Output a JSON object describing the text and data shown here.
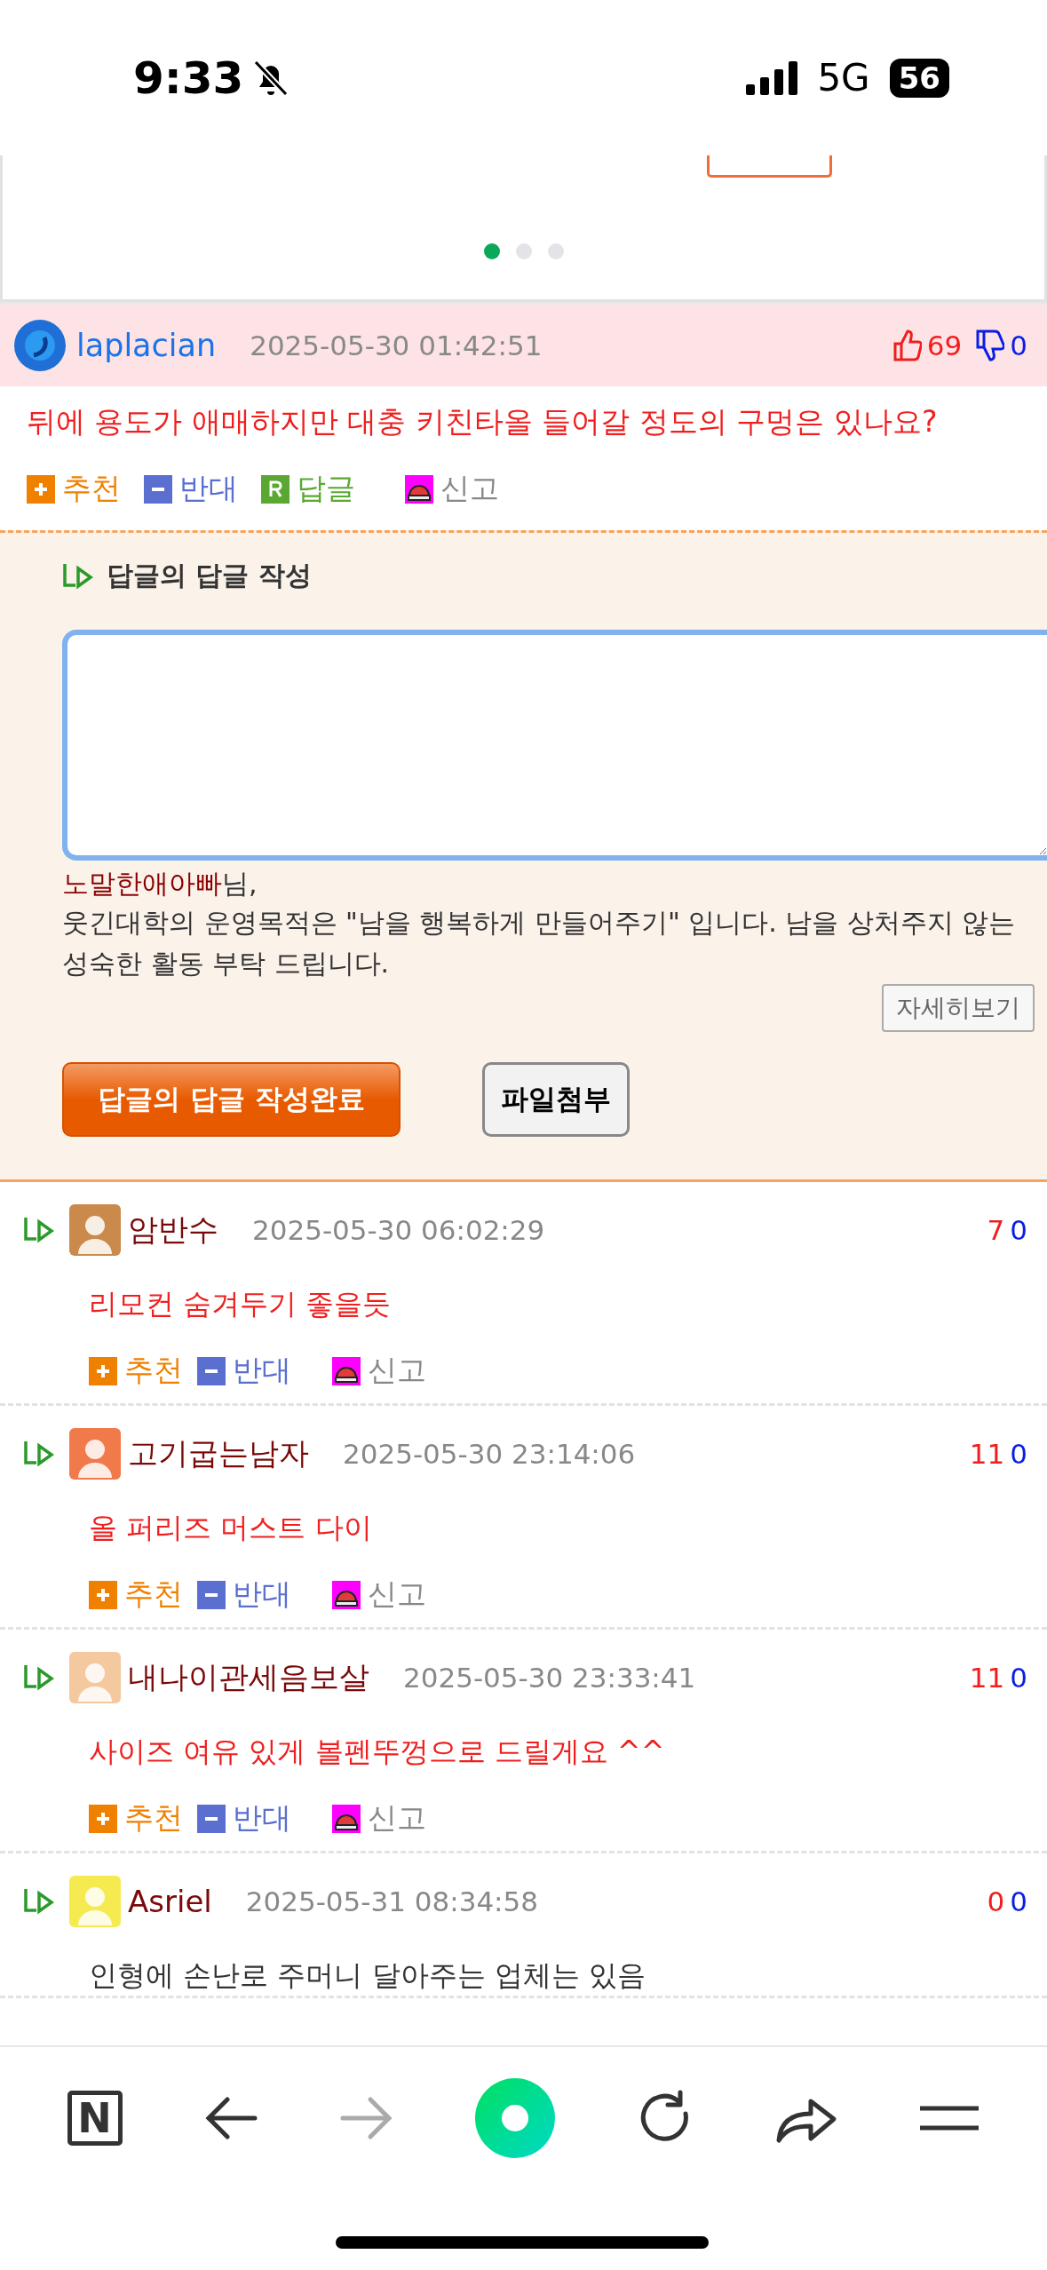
{
  "status_bar": {
    "time": "9:33",
    "network": "5G",
    "battery": "56"
  },
  "carousel": {
    "dots": [
      {
        "selected": true
      },
      {
        "selected": false
      },
      {
        "selected": false
      }
    ]
  },
  "comment": {
    "author": "laplacian",
    "date": "2025-05-30 01:42:51",
    "likes": "69",
    "dislikes": "0",
    "text": "뒤에 용도가 애매하지만 대충 키친타올 들어갈 정도의 구멍은 있나요?",
    "actions": [
      {
        "kind": "up",
        "label": "추천"
      },
      {
        "kind": "down",
        "label": "반대"
      },
      {
        "kind": "reply",
        "label": "답글"
      },
      {
        "kind": "report",
        "label": "신고"
      }
    ]
  },
  "reply_form": {
    "title": "답글의 답글 작성",
    "notice_name": "노말한애아빠",
    "notice_suffix": "님,",
    "notice_text": "웃긴대학의 운영목적은 \"남을 행복하게 만들어주기\" 입니다. 남을 상처주지 않는 성숙한 활동 부탁 드립니다.",
    "detail_button": "자세히보기",
    "submit_button": "답글의 답글 작성완료",
    "attach_button": "파일첨부"
  },
  "replies": [
    {
      "author": "암반수",
      "date": "2025-05-30 06:02:29",
      "likes": "7",
      "dislikes": "0",
      "text": "리모컨 숨겨두기 좋을듯",
      "color": "#f01e1e",
      "actions": [
        {
          "kind": "up",
          "label": "추천"
        },
        {
          "kind": "down",
          "label": "반대"
        },
        {
          "kind": "report",
          "label": "신고"
        }
      ]
    },
    {
      "author": "고기굽는남자",
      "date": "2025-05-30 23:14:06",
      "likes": "11",
      "dislikes": "0",
      "text": "올 퍼리즈 머스트 다이",
      "color": "#f01e1e",
      "actions": [
        {
          "kind": "up",
          "label": "추천"
        },
        {
          "kind": "down",
          "label": "반대"
        },
        {
          "kind": "report",
          "label": "신고"
        }
      ]
    },
    {
      "author": "내나이관세음보살",
      "date": "2025-05-30 23:33:41",
      "likes": "11",
      "dislikes": "0",
      "text": "사이즈 여유 있게 볼펜뚜껑으로 드릴게요 ^^",
      "color": "#f01e1e",
      "actions": [
        {
          "kind": "up",
          "label": "추천"
        },
        {
          "kind": "down",
          "label": "반대"
        },
        {
          "kind": "report",
          "label": "신고"
        }
      ]
    },
    {
      "author": "Asriel",
      "date": "2025-05-31 08:34:58",
      "likes": "0",
      "dislikes": "0",
      "text": "인형에 손난로 주머니 달아주는 업체는 있음",
      "color": "#333333"
    }
  ],
  "toolbar": [
    {
      "kind": "logo",
      "label": "N",
      "disabled": false
    },
    {
      "kind": "back",
      "disabled": false
    },
    {
      "kind": "forward",
      "disabled": true
    },
    {
      "kind": "home",
      "disabled": false
    },
    {
      "kind": "reload",
      "disabled": false
    },
    {
      "kind": "share",
      "disabled": false
    },
    {
      "kind": "menu",
      "disabled": false
    }
  ]
}
